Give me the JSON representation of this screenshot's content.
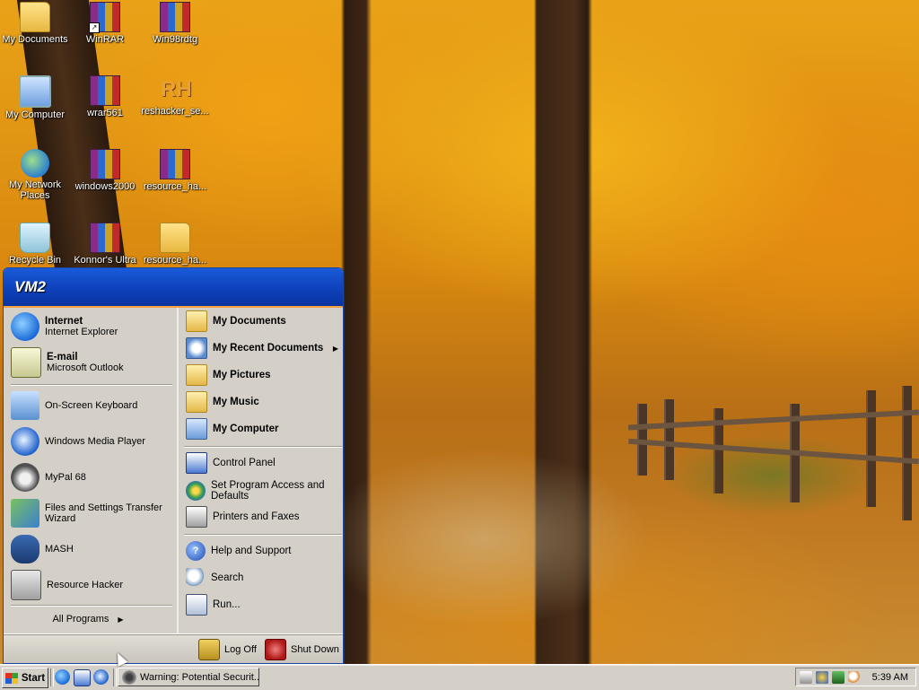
{
  "desktop": {
    "icons": [
      {
        "label": "My Documents",
        "icon": "folder-documents-icon"
      },
      {
        "label": "WinRAR",
        "icon": "winrar-icon"
      },
      {
        "label": "Win98rdtg",
        "icon": "winrar-archive-icon"
      },
      {
        "label": "My Computer",
        "icon": "computer-icon"
      },
      {
        "label": "wrar561",
        "icon": "winrar-archive-icon"
      },
      {
        "label": "reshacker_se...",
        "icon": "resource-hacker-icon"
      },
      {
        "label": "My Network Places",
        "icon": "network-icon"
      },
      {
        "label": "windows2000",
        "icon": "winrar-archive-icon"
      },
      {
        "label": "resource_ha...",
        "icon": "winrar-archive-icon"
      },
      {
        "label": "Recycle Bin",
        "icon": "recycle-bin-icon"
      },
      {
        "label": "Konnor's Ultra",
        "icon": "winrar-archive-icon"
      },
      {
        "label": "resource_ha...",
        "icon": "folder-icon"
      }
    ]
  },
  "start_menu": {
    "user": "VM2",
    "pinned": [
      {
        "title": "Internet",
        "subtitle": "Internet Explorer",
        "icon": "internet-explorer-icon"
      },
      {
        "title": "E-mail",
        "subtitle": "Microsoft Outlook",
        "icon": "email-icon"
      }
    ],
    "recent": [
      {
        "label": "On-Screen Keyboard",
        "icon": "keyboard-icon"
      },
      {
        "label": "Windows Media Player",
        "icon": "media-player-icon"
      },
      {
        "label": "MyPal 68",
        "icon": "mypal-icon"
      },
      {
        "label": "Files and Settings Transfer Wizard",
        "icon": "transfer-wizard-icon"
      },
      {
        "label": "MASH",
        "icon": "mash-icon"
      },
      {
        "label": "Resource Hacker",
        "icon": "resource-hacker-icon"
      }
    ],
    "all_programs": "All Programs",
    "places": [
      {
        "label": "My Documents",
        "icon": "documents-folder-icon"
      },
      {
        "label": "My Recent Documents",
        "icon": "recent-documents-icon"
      },
      {
        "label": "My Pictures",
        "icon": "pictures-folder-icon"
      },
      {
        "label": "My Music",
        "icon": "music-folder-icon"
      },
      {
        "label": "My Computer",
        "icon": "computer-icon"
      }
    ],
    "settings": [
      {
        "label": "Control Panel",
        "icon": "control-panel-icon"
      },
      {
        "label": "Set Program Access and Defaults",
        "icon": "program-defaults-icon"
      },
      {
        "label": "Printers and Faxes",
        "icon": "printer-icon"
      }
    ],
    "tools": [
      {
        "label": "Help and Support",
        "icon": "help-icon"
      },
      {
        "label": "Search",
        "icon": "search-icon"
      },
      {
        "label": "Run...",
        "icon": "run-icon"
      }
    ],
    "log_off": "Log Off",
    "shut_down": "Shut Down"
  },
  "taskbar": {
    "start_label": "Start",
    "task_window": "Warning: Potential Securit...",
    "clock": "5:39 AM"
  },
  "colors": {
    "menu_header": "#0d3fb8",
    "menu_body": "#d4d0c8",
    "header_accent": "#f5a040"
  }
}
